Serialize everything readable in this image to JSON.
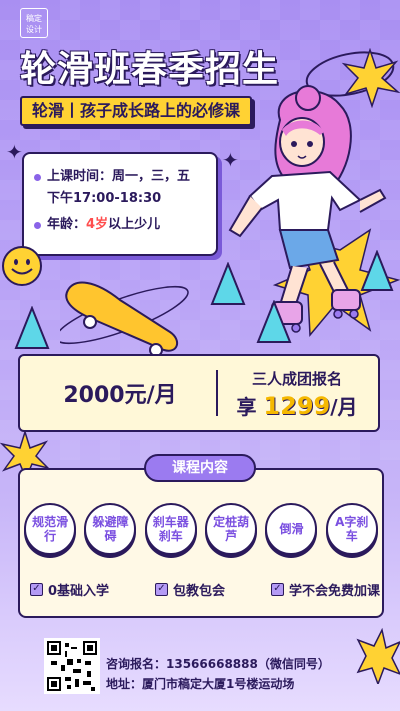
{
  "brand": {
    "logo_text_1": "稿定",
    "logo_text_2": "设计"
  },
  "header": {
    "title": "轮滑班春季招生",
    "subtitle": "轮滑丨孩子成长路上的必修课"
  },
  "info": {
    "time_label": "上课时间：周一，三，五",
    "time_value": "下午17:00-18:30",
    "age_prefix": "年龄：",
    "age_highlight": "4岁",
    "age_suffix": "以上少儿"
  },
  "pricing": {
    "monthly": "2000元/月",
    "group_label": "三人成团报名",
    "group_prefix": "享",
    "group_price": "1299",
    "group_suffix": "/月"
  },
  "courses": {
    "section_title": "课程内容",
    "items": [
      "规范滑行",
      "躲避障碍",
      "刹车器刹车",
      "定桩葫芦",
      "倒滑",
      "A字刹车"
    ]
  },
  "features": [
    "0基础入学",
    "包教包会",
    "学不会免费加课"
  ],
  "contact": {
    "phone": "咨询报名：13566668888（微信同号）",
    "address": "地址：厦门市稿定大厦1号楼运动场"
  },
  "colors": {
    "background": "#b9a3f6",
    "accent_yellow": "#ffd233",
    "outline": "#2b1a5c",
    "purple": "#9b7bf0",
    "cyan": "#4fd1e8"
  },
  "icons": [
    "smiley-icon",
    "star-burst-icon",
    "sparkle-icon",
    "cone-icon",
    "skateboard-icon",
    "qr-code-icon",
    "checkbox-icon"
  ]
}
